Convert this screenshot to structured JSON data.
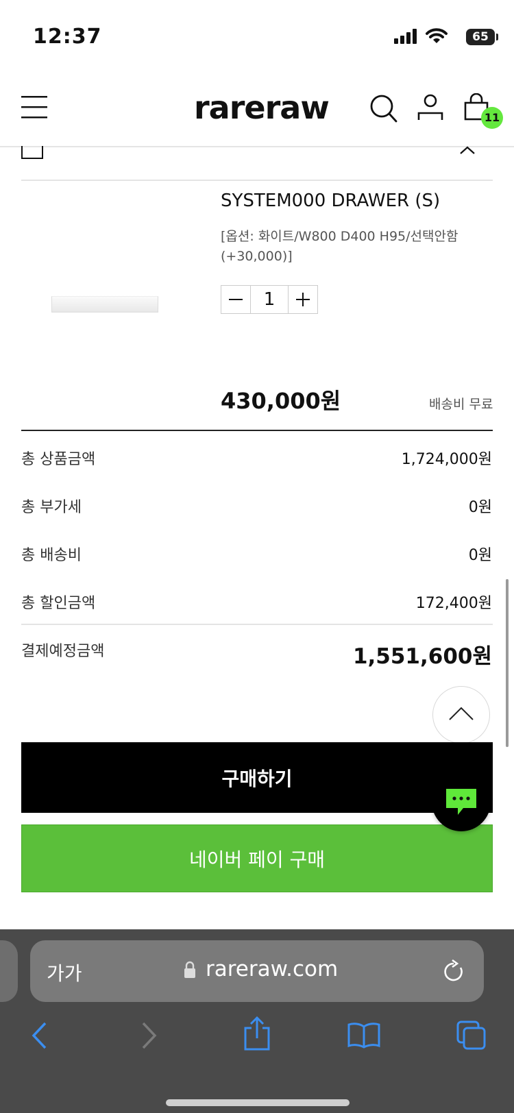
{
  "status_bar": {
    "time": "12:37",
    "battery": "65"
  },
  "header": {
    "logo": "rareraw",
    "cart_count": "11"
  },
  "cart_item": {
    "name": "SYSTEM000 DRAWER (S)",
    "option": "[옵션: 화이트/W800 D400 H95/선택안함 (+30,000)]",
    "quantity": "1",
    "price": "430,000원",
    "shipping": "배송비 무료"
  },
  "summary": {
    "rows": [
      {
        "label": "총 상품금액",
        "value": "1,724,000원"
      },
      {
        "label": "총 부가세",
        "value": "0원"
      },
      {
        "label": "총 배송비",
        "value": "0원"
      },
      {
        "label": "총 할인금액",
        "value": "172,400원"
      }
    ],
    "payment_label": "결제예정금액",
    "payment_value": "1,551,600원"
  },
  "buttons": {
    "buy": "구매하기",
    "naver_pay": "네이버 페이 구매"
  },
  "safari": {
    "text_size": "가가",
    "url": "rareraw.com"
  },
  "colors": {
    "naver_green": "#5bbf3a",
    "badge_green": "#64e83e",
    "ios_blue": "#3b8ef0"
  }
}
